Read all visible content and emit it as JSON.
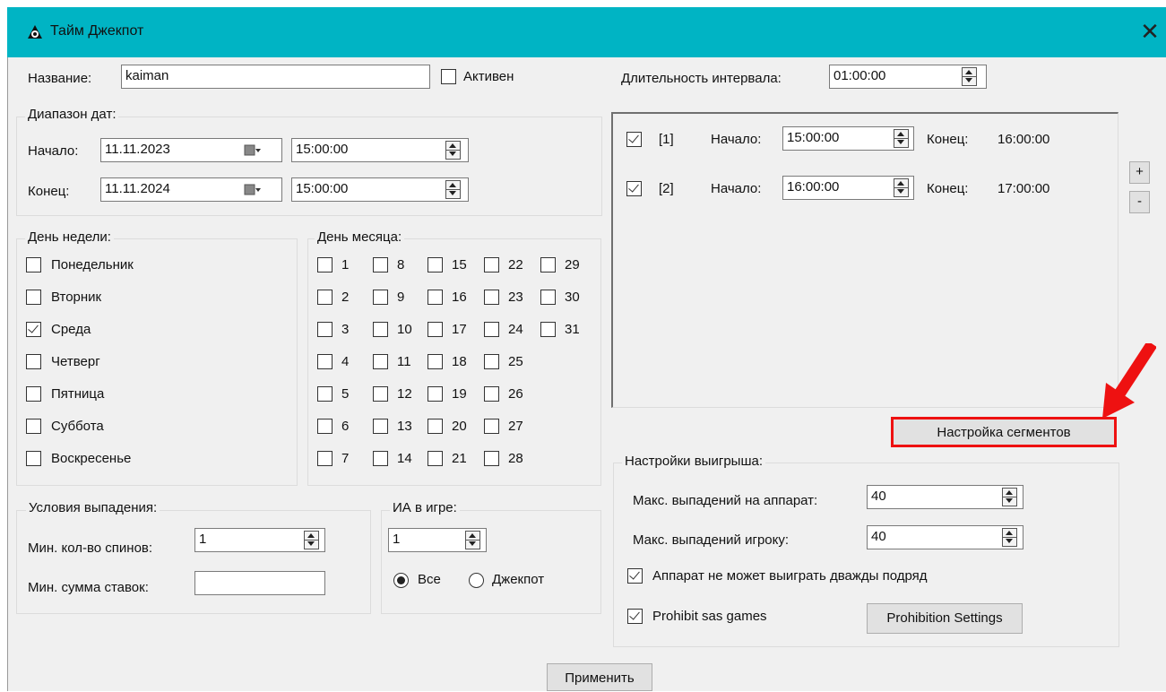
{
  "window": {
    "title": "Тайм Джекпот",
    "icon": "app-icon",
    "close_icon": "close-icon"
  },
  "name_row": {
    "label": "Название:",
    "value": "kaiman",
    "active_label": "Активен",
    "active_checked": false
  },
  "interval": {
    "label": "Длительность интервала:",
    "value": "01:00:00"
  },
  "date_range": {
    "title": "Диапазон дат:",
    "start_label": "Начало:",
    "start_date": "11.11.2023",
    "start_time": "15:00:00",
    "end_label": "Конец:",
    "end_date": "11.11.2024",
    "end_time": "15:00:00"
  },
  "weekday": {
    "title": "День недели:",
    "items": [
      {
        "label": "Понедельник",
        "checked": false
      },
      {
        "label": "Вторник",
        "checked": false
      },
      {
        "label": "Среда",
        "checked": true
      },
      {
        "label": "Четверг",
        "checked": false
      },
      {
        "label": "Пятница",
        "checked": false
      },
      {
        "label": "Суббота",
        "checked": false
      },
      {
        "label": "Воскресенье",
        "checked": false
      }
    ]
  },
  "monthday": {
    "title": "День месяца:",
    "columns": [
      [
        "1",
        "2",
        "3",
        "4",
        "5",
        "6",
        "7"
      ],
      [
        "8",
        "9",
        "10",
        "11",
        "12",
        "13",
        "14"
      ],
      [
        "15",
        "16",
        "17",
        "18",
        "19",
        "20",
        "21"
      ],
      [
        "22",
        "23",
        "24",
        "25",
        "26",
        "27",
        "28"
      ],
      [
        "29",
        "30",
        "31"
      ]
    ]
  },
  "intervals": [
    {
      "checked": true,
      "index": "[1]",
      "start_label": "Начало:",
      "start": "15:00:00",
      "end_label": "Конец:",
      "end": "16:00:00"
    },
    {
      "checked": true,
      "index": "[2]",
      "start_label": "Начало:",
      "start": "16:00:00",
      "end_label": "Конец:",
      "end": "17:00:00"
    }
  ],
  "list_buttons": {
    "add": "+",
    "remove": "-"
  },
  "segments_button": "Настройка сегментов",
  "drop_conditions": {
    "title": "Условия выпадения:",
    "min_spins_label": "Мин. кол-во спинов:",
    "min_spins": "1",
    "min_bets_label": "Мин. сумма ставок:",
    "min_bets": ""
  },
  "ia_game": {
    "title": "ИА в игре:",
    "value": "1",
    "radio_all": "Все",
    "radio_jackpot": "Джекпот",
    "selected": "all"
  },
  "win_settings": {
    "title": "Настройки выигрыша:",
    "max_per_machine_label": "Макс. выпадений на аппарат:",
    "max_per_machine": "40",
    "max_per_player_label": "Макс. выпадений игроку:",
    "max_per_player": "40",
    "no_twice_label": "Аппарат не может выиграть дважды подряд",
    "no_twice_checked": true,
    "prohibit_sas_label": "Prohibit sas games",
    "prohibit_sas_checked": true,
    "prohibition_button": "Prohibition Settings"
  },
  "apply_button": "Применить",
  "annotation": {
    "color": "#ee1111"
  }
}
